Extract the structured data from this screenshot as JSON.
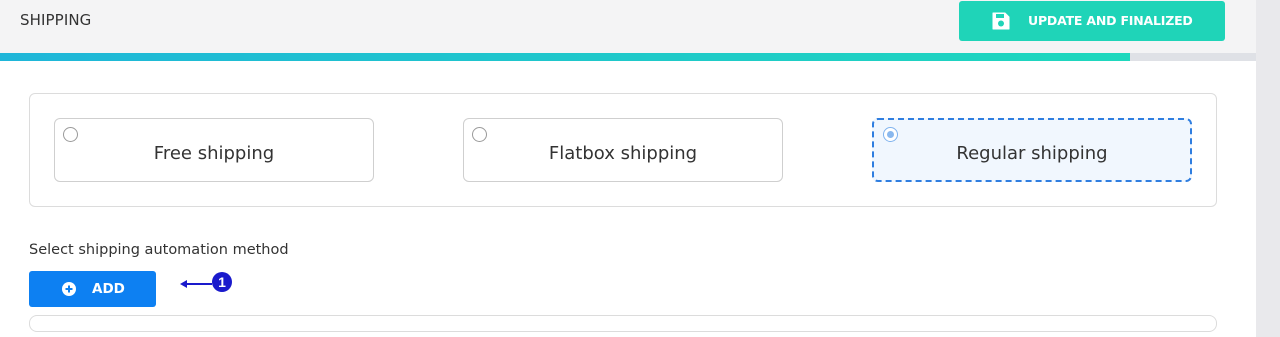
{
  "header": {
    "title": "SHIPPING",
    "update_button_label": "UPDATE AND FINALIZED",
    "update_button_icon": "save-icon",
    "update_button_color": "#1fd4b8"
  },
  "progress": {
    "value_percent": 90
  },
  "shipping_options": [
    {
      "label": "Free shipping",
      "selected": false
    },
    {
      "label": "Flatbox shipping",
      "selected": false
    },
    {
      "label": "Regular shipping",
      "selected": true
    }
  ],
  "automation": {
    "label": "Select shipping automation method",
    "add_button_label": "ADD",
    "add_button_icon": "plus-circle-icon",
    "add_button_color": "#0d80f2"
  },
  "annotation": {
    "marker_number": "1",
    "marker_color": "#1a1acc"
  }
}
